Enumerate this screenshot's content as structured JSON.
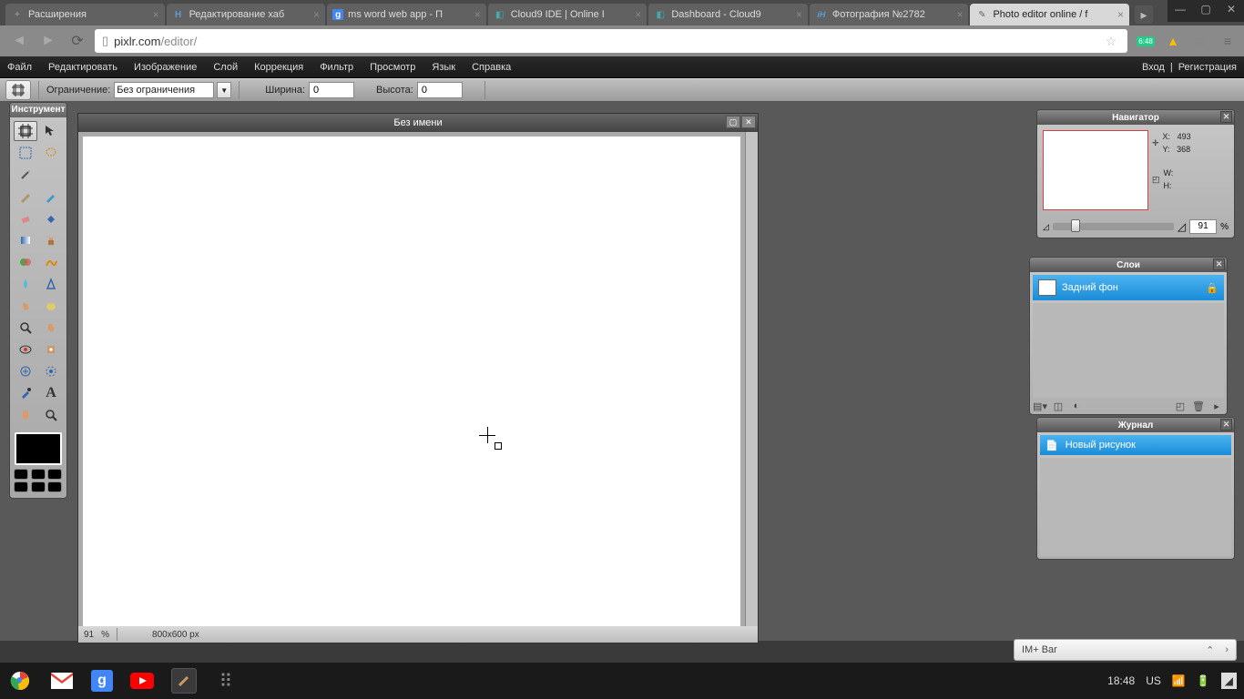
{
  "window_controls": {
    "min": "—",
    "max": "▢",
    "close": "✕"
  },
  "tabs": [
    {
      "icon": "✦",
      "text": "Расширения",
      "iconColor": "#888"
    },
    {
      "icon": "H",
      "text": "Редактирование хаб",
      "iconColor": "#5a9fd4"
    },
    {
      "icon": "g",
      "text": "ms word web app - П",
      "iconColor": "#4285f4"
    },
    {
      "icon": "◧",
      "text": "Cloud9 IDE | Online I",
      "iconColor": "#4aa"
    },
    {
      "icon": "◧",
      "text": "Dashboard - Cloud9",
      "iconColor": "#4aa"
    },
    {
      "icon": "iH",
      "text": "Фотография №2782",
      "iconColor": "#5a9fd4"
    },
    {
      "icon": "✎",
      "text": "Photo editor online / f",
      "iconColor": "#888"
    }
  ],
  "address": {
    "domain": "pixlr.com",
    "path": "/editor/"
  },
  "menu": {
    "items": [
      "Файл",
      "Редактировать",
      "Изображение",
      "Слой",
      "Коррекция",
      "Фильтр",
      "Просмотр",
      "Язык",
      "Справка"
    ],
    "login": "Вход",
    "sep": "|",
    "register": "Регистрация"
  },
  "options": {
    "constraint_label": "Ограничение:",
    "constraint_value": "Без ограничения",
    "width_label": "Ширина:",
    "width_value": "0",
    "height_label": "Высота:",
    "height_value": "0"
  },
  "tools_title": "Инструмент",
  "doc": {
    "title": "Без имени",
    "zoom": "91",
    "pct": "%",
    "dims": "800x600 px"
  },
  "nav_panel": {
    "title": "Навигатор",
    "x_label": "X:",
    "x_val": "493",
    "y_label": "Y:",
    "y_val": "368",
    "w_label": "W:",
    "h_label": "H:",
    "zoom": "91",
    "pct": "%"
  },
  "layers_panel": {
    "title": "Слои",
    "bg_layer": "Задний фон"
  },
  "history_panel": {
    "title": "Журнал",
    "item": "Новый рисунок"
  },
  "im_bar": "IM+ Bar",
  "taskbar": {
    "time": "18:48",
    "lang": "US"
  }
}
